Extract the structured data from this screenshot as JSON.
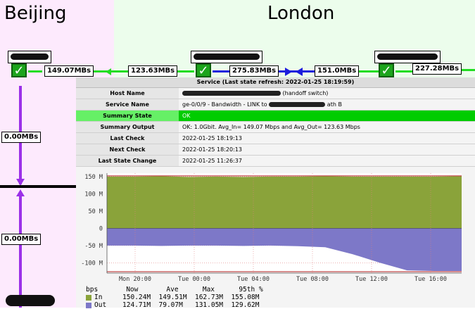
{
  "regions": {
    "beijing": "Beijing",
    "london": "London"
  },
  "links": {
    "rate_beijing_out": "149.07MBs",
    "rate_london_in": "123.63MBs",
    "rate_london_mid_left": "275.83MBs",
    "rate_london_mid_right": "151.0MBs",
    "rate_right": "227.28MBs",
    "vertical_top": "0.00MBs",
    "vertical_bottom": "0.00MBs"
  },
  "service": {
    "header": "Service (Last state refresh: 2022-01-25 18:19:59)",
    "rows": [
      {
        "key": "Host Name",
        "value": "(handoff switch)"
      },
      {
        "key": "Service Name",
        "value": "ge-0/0/9 - Bandwidth - LINK to",
        "value_tail": "ath B"
      },
      {
        "key": "Summary State",
        "value": "OK"
      },
      {
        "key": "Summary Output",
        "value": "OK: 1.0Gbit. Avg_In= 149.07 Mbps and Avg_Out= 123.63 Mbps"
      },
      {
        "key": "Last Check",
        "value": "2022-01-25 18:19:13"
      },
      {
        "key": "Next Check",
        "value": "2022-01-25 18:20:13"
      },
      {
        "key": "Last State Change",
        "value": "2022-01-25 11:26:37"
      }
    ]
  },
  "chart_data": {
    "type": "area",
    "title": "",
    "ylabel": "",
    "ylim": [
      -130,
      160
    ],
    "yticks": [
      "150 M",
      "100 M",
      "50 M",
      "0",
      "-50 M",
      "-100 M"
    ],
    "xticks": [
      "Mon 20:00",
      "Tue 00:00",
      "Tue 04:00",
      "Tue 08:00",
      "Tue 12:00",
      "Tue 16:00"
    ],
    "grid": true,
    "series": [
      {
        "name": "In",
        "color": "#8aa33a",
        "values": [
          150,
          150,
          151,
          149,
          150,
          149,
          150,
          150,
          151,
          150,
          150,
          150,
          150,
          151
        ]
      },
      {
        "name": "Out",
        "color": "#7d78c8",
        "values": [
          -50,
          -50,
          -51,
          -50,
          -50,
          -51,
          -50,
          -52,
          -55,
          -75,
          -100,
          -122,
          -124,
          -124
        ]
      }
    ],
    "legend": {
      "header": [
        "bps",
        "Now",
        "Ave",
        "Max",
        "95th %"
      ],
      "rows": [
        [
          "In",
          "150.24M",
          "149.51M",
          "162.73M",
          "155.08M"
        ],
        [
          "Out",
          "124.71M",
          "79.07M",
          "131.05M",
          "129.62M"
        ]
      ]
    }
  },
  "colors": {
    "in": "#8aa33a",
    "out": "#7d78c8",
    "ok": "#00cc00",
    "link_green": "#22dd22",
    "link_blue": "#1c1cdd",
    "vertical": "#9b30e8"
  },
  "icons": {
    "status": "check-icon"
  }
}
